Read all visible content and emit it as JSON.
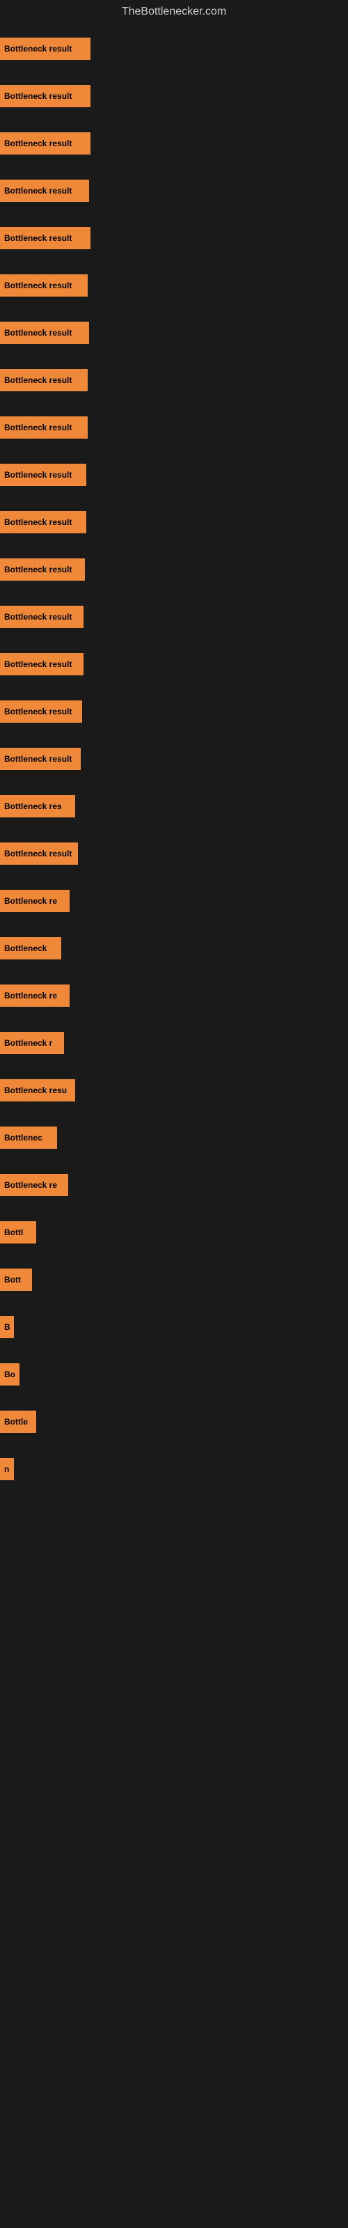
{
  "site_title": "TheBottlenecker.com",
  "bars": [
    {
      "label": "Bottleneck result",
      "width": 130
    },
    {
      "label": "Bottleneck result",
      "width": 130
    },
    {
      "label": "Bottleneck result",
      "width": 130
    },
    {
      "label": "Bottleneck result",
      "width": 128
    },
    {
      "label": "Bottleneck result",
      "width": 130
    },
    {
      "label": "Bottleneck result",
      "width": 126
    },
    {
      "label": "Bottleneck result",
      "width": 128
    },
    {
      "label": "Bottleneck result",
      "width": 126
    },
    {
      "label": "Bottleneck result",
      "width": 126
    },
    {
      "label": "Bottleneck result",
      "width": 124
    },
    {
      "label": "Bottleneck result",
      "width": 124
    },
    {
      "label": "Bottleneck result",
      "width": 122
    },
    {
      "label": "Bottleneck result",
      "width": 120
    },
    {
      "label": "Bottleneck result",
      "width": 120
    },
    {
      "label": "Bottleneck result",
      "width": 118
    },
    {
      "label": "Bottleneck result",
      "width": 116
    },
    {
      "label": "Bottleneck res",
      "width": 108
    },
    {
      "label": "Bottleneck result",
      "width": 112
    },
    {
      "label": "Bottleneck re",
      "width": 100
    },
    {
      "label": "Bottleneck",
      "width": 88
    },
    {
      "label": "Bottleneck re",
      "width": 100
    },
    {
      "label": "Bottleneck r",
      "width": 92
    },
    {
      "label": "Bottleneck resu",
      "width": 108
    },
    {
      "label": "Bottlenec",
      "width": 82
    },
    {
      "label": "Bottleneck re",
      "width": 98
    },
    {
      "label": "Bottl",
      "width": 52
    },
    {
      "label": "Bott",
      "width": 46
    },
    {
      "label": "B",
      "width": 18
    },
    {
      "label": "Bo",
      "width": 28
    },
    {
      "label": "Bottle",
      "width": 52
    },
    {
      "label": "n",
      "width": 12
    }
  ],
  "colors": {
    "bar_fill": "#f0883a",
    "background": "#1a1a1a",
    "title_text": "#cccccc",
    "bar_text": "#000000"
  }
}
